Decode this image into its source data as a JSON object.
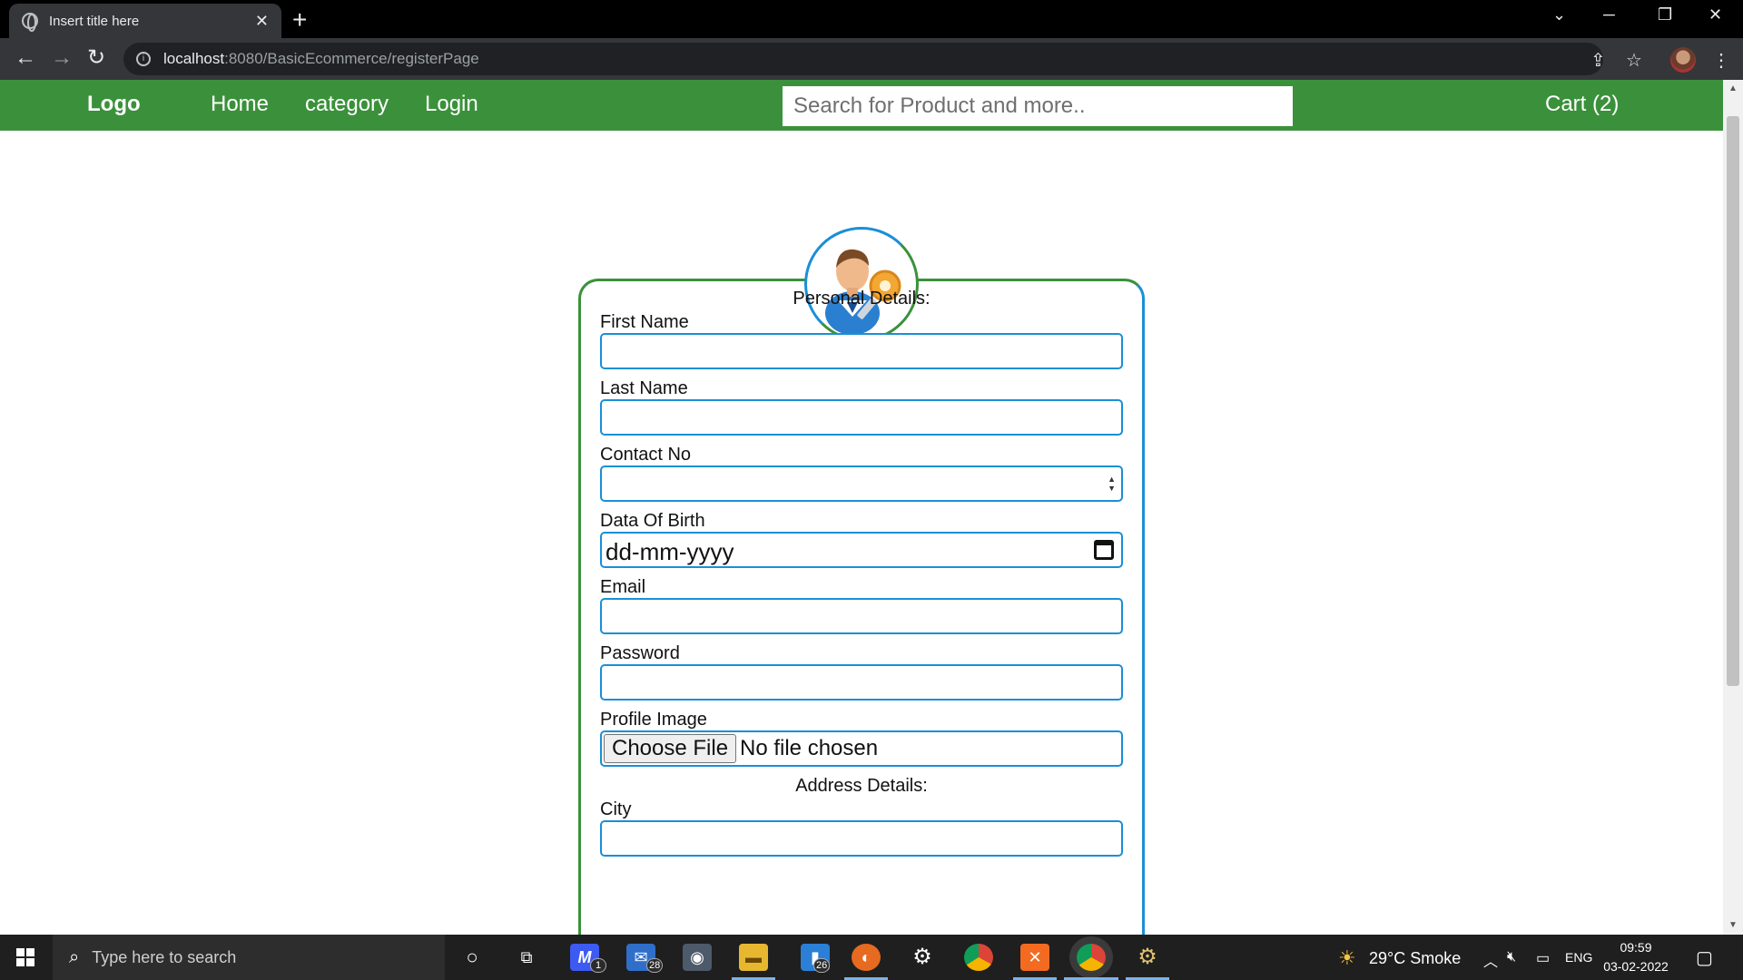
{
  "browser": {
    "tab_title": "Insert title here",
    "tab_close": "✕",
    "new_tab": "+",
    "url_host": "localhost",
    "url_path": ":8080/BasicEcommerce/registerPage"
  },
  "navbar": {
    "logo": "Logo",
    "links": [
      "Home",
      "category",
      "Login"
    ],
    "search_placeholder": "Search for Product and more..",
    "cart": "Cart (2)"
  },
  "form": {
    "personal_heading": "Personal Details:",
    "first_name_label": "First Name",
    "last_name_label": "Last Name",
    "contact_label": "Contact No",
    "dob_label": "Data Of Birth",
    "dob_placeholder": "dd-mm-yyyy",
    "email_label": "Email",
    "password_label": "Password",
    "profile_image_label": "Profile Image",
    "choose_file": "Choose File",
    "file_status": "No file chosen",
    "address_heading": "Address Details:",
    "city_label": "City"
  },
  "taskbar": {
    "search_text": "Type here to search",
    "badges": [
      "1",
      "28",
      "26"
    ],
    "weather": "29°C  Smoke",
    "language": "ENG",
    "time": "09:59",
    "date": "03-02-2022"
  }
}
